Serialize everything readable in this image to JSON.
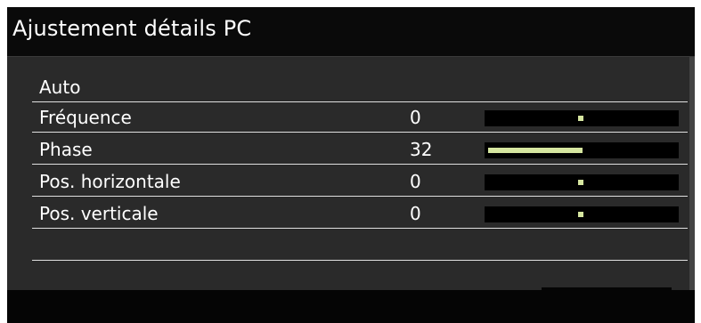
{
  "window": {
    "title": "Ajustement détails PC"
  },
  "menu": {
    "items": [
      {
        "label": "Auto",
        "value": "",
        "has_slider": false
      },
      {
        "label": "Fréquence",
        "value": "0",
        "has_slider": true,
        "slider_type": "center",
        "slider_level": 0.5
      },
      {
        "label": "Phase",
        "value": "32",
        "has_slider": true,
        "slider_type": "fill",
        "slider_level": 0.5
      },
      {
        "label": "Pos. horizontale",
        "value": "0",
        "has_slider": true,
        "slider_type": "center",
        "slider_level": 0.5
      },
      {
        "label": "Pos. verticale",
        "value": "0",
        "has_slider": true,
        "slider_type": "center",
        "slider_level": 0.5
      }
    ]
  },
  "colors": {
    "background": "#2a2a2a",
    "title_bar": "#0a0a0a",
    "text": "#ffffff",
    "slider_track": "#000000",
    "slider_indicator": "#d6e6a0",
    "divider": "#e0e0e0"
  }
}
